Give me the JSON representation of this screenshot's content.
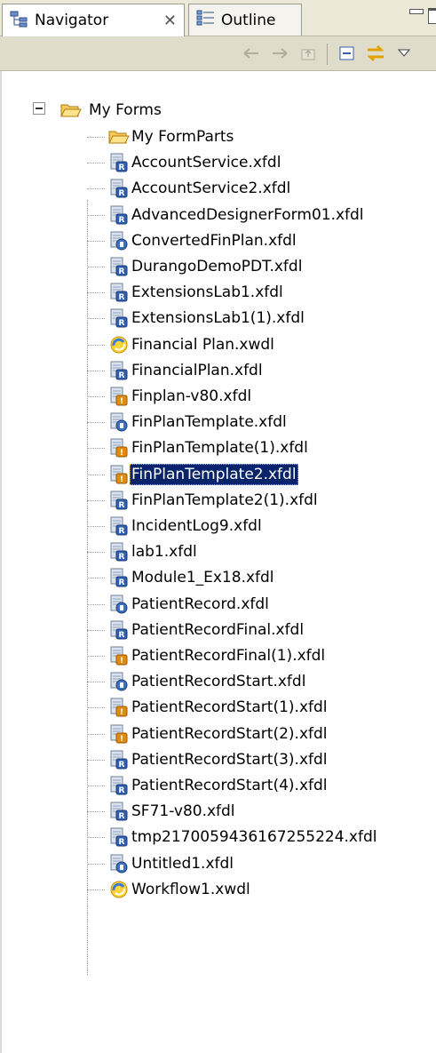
{
  "tabs": {
    "navigator_label": "Navigator",
    "outline_label": "Outline"
  },
  "toolbar": {
    "icons": [
      "back-arrow-icon",
      "forward-arrow-icon",
      "go-up-icon",
      "collapse-all-icon",
      "link-editor-icon",
      "view-menu-icon"
    ]
  },
  "tree": {
    "root_label": "My Forms",
    "selected_index": 13,
    "items": [
      {
        "label": "My FormParts",
        "icon": "folder"
      },
      {
        "label": "AccountService.xfdl",
        "icon": "xfdl-r"
      },
      {
        "label": "AccountService2.xfdl",
        "icon": "xfdl-r"
      },
      {
        "label": "AdvancedDesignerForm01.xfdl",
        "icon": "xfdl-r"
      },
      {
        "label": "ConvertedFinPlan.xfdl",
        "icon": "xfdl-blue"
      },
      {
        "label": "DurangoDemoPDT.xfdl",
        "icon": "xfdl-r"
      },
      {
        "label": "ExtensionsLab1.xfdl",
        "icon": "xfdl-r"
      },
      {
        "label": "ExtensionsLab1(1).xfdl",
        "icon": "xfdl-r"
      },
      {
        "label": "Financial Plan.xwdl",
        "icon": "xwdl"
      },
      {
        "label": "FinancialPlan.xfdl",
        "icon": "xfdl-r"
      },
      {
        "label": "Finplan-v80.xfdl",
        "icon": "xfdl-orange"
      },
      {
        "label": "FinPlanTemplate.xfdl",
        "icon": "xfdl-blue"
      },
      {
        "label": "FinPlanTemplate(1).xfdl",
        "icon": "xfdl-orange"
      },
      {
        "label": "FinPlanTemplate2.xfdl",
        "icon": "xfdl-orange"
      },
      {
        "label": "FinPlanTemplate2(1).xfdl",
        "icon": "xfdl-r"
      },
      {
        "label": "IncidentLog9.xfdl",
        "icon": "xfdl-r"
      },
      {
        "label": "lab1.xfdl",
        "icon": "xfdl-r"
      },
      {
        "label": "Module1_Ex18.xfdl",
        "icon": "xfdl-r"
      },
      {
        "label": "PatientRecord.xfdl",
        "icon": "xfdl-blue"
      },
      {
        "label": "PatientRecordFinal.xfdl",
        "icon": "xfdl-r"
      },
      {
        "label": "PatientRecordFinal(1).xfdl",
        "icon": "xfdl-orange"
      },
      {
        "label": "PatientRecordStart.xfdl",
        "icon": "xfdl-blue"
      },
      {
        "label": "PatientRecordStart(1).xfdl",
        "icon": "xfdl-orange"
      },
      {
        "label": "PatientRecordStart(2).xfdl",
        "icon": "xfdl-orange"
      },
      {
        "label": "PatientRecordStart(3).xfdl",
        "icon": "xfdl-r"
      },
      {
        "label": "PatientRecordStart(4).xfdl",
        "icon": "xfdl-r"
      },
      {
        "label": "SF71-v80.xfdl",
        "icon": "xfdl-r"
      },
      {
        "label": "tmp2170059436167255224.xfdl",
        "icon": "xfdl-r"
      },
      {
        "label": "Untitled1.xfdl",
        "icon": "xfdl-blue"
      },
      {
        "label": "Workflow1.xwdl",
        "icon": "xwdl"
      }
    ]
  },
  "colors": {
    "selection_bg": "#0a246a",
    "selection_text": "#ffffff",
    "tab_bg": "#ece9d8"
  }
}
